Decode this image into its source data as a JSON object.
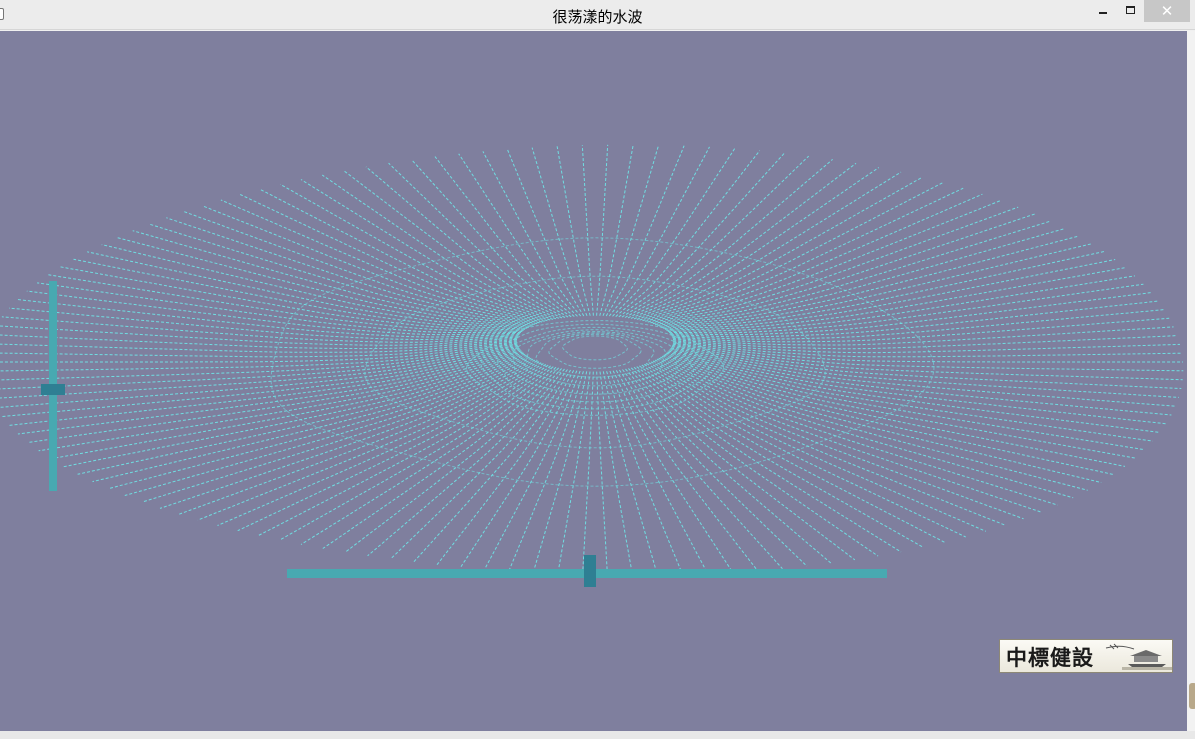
{
  "window": {
    "title": "很荡漾的水波",
    "minimize_label": "–",
    "maximize_label": "▢",
    "close_label": "✕"
  },
  "icons": {
    "app": "app-icon",
    "minimize": "minimize-icon",
    "maximize": "maximize-icon",
    "close": "close-icon"
  },
  "canvas": {
    "background": "#7f7f9e",
    "line_color": "#6fe3e6"
  },
  "sliders": {
    "vertical": {
      "value": 0.52,
      "color": "#48a9b1",
      "thumb_color": "#2f7f93"
    },
    "horizontal": {
      "value": 0.505,
      "color": "#48a9b1",
      "thumb_color": "#2f7f93"
    }
  },
  "logo": {
    "text": "中標健設"
  }
}
